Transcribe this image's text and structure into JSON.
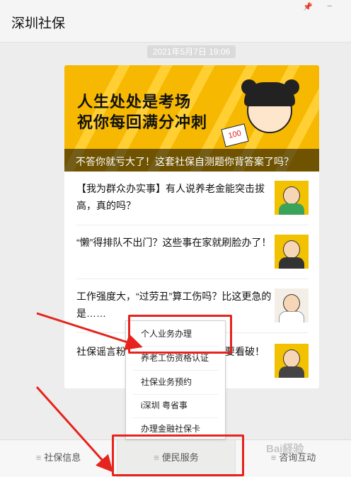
{
  "window": {
    "title": "深圳社保",
    "pin_icon": "pin-icon",
    "close_icon": "close-icon"
  },
  "chat": {
    "timestamp": "2021年5月7日 19:06"
  },
  "article": {
    "banner": {
      "slogan_line1": "人生处处是考场",
      "slogan_line2": "祝你每回满分冲刺",
      "paper_text": "100",
      "caption": "不答你就亏大了！这套社保自测题你背答案了吗？"
    },
    "items": [
      {
        "title": "【我为群众办实事】有人说养老金能突击拔高，真的吗？",
        "thumb": "group-cheer-thumbnail"
      },
      {
        "title": "“懒”得排队不出门？这些事在家就刷脸办了！",
        "thumb": "businessman-thumbnail"
      },
      {
        "title": "工作强度大，“过劳丑”算工伤吗？比这更急的是……",
        "thumb": "doctor-thumbnail"
      },
      {
        "title": "社保谣言粉碎机，这些谣言你一定要看破！",
        "thumb": "thumbsup-thumbnail"
      }
    ]
  },
  "popup_menu": {
    "items": [
      "个人业务办理",
      "养老工伤资格认证",
      "社保业务预约",
      "i深圳 粤省事",
      "办理金融社保卡"
    ]
  },
  "bottom_menu": {
    "tabs": [
      {
        "icon": "menu-lines-icon",
        "label": "社保信息"
      },
      {
        "icon": "menu-lines-icon",
        "label": "便民服务"
      },
      {
        "icon": "menu-lines-icon",
        "label": "咨询互动"
      }
    ]
  },
  "watermark": "Bai経验",
  "colors": {
    "highlight": "#e6231c",
    "banner": "#f6b800",
    "background": "#ededed"
  }
}
